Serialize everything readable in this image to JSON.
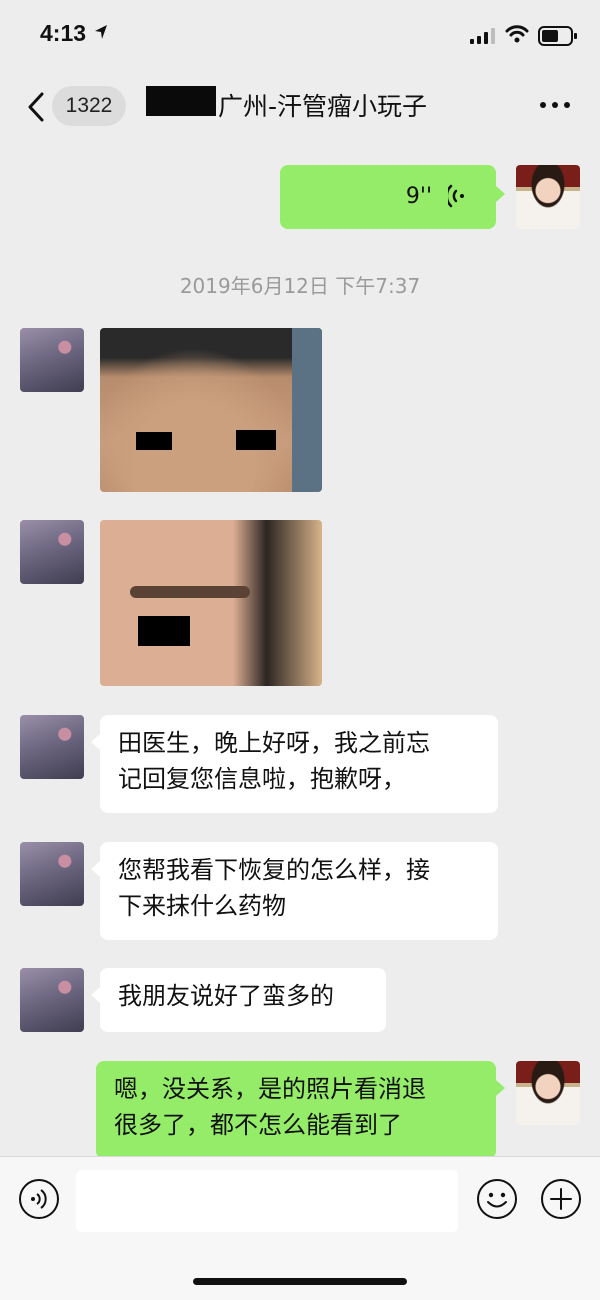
{
  "status_bar": {
    "time": "4:13"
  },
  "nav": {
    "unread_count": "1322",
    "title": "广州-汗管瘤小玩子"
  },
  "messages": {
    "voice": {
      "duration": "9''"
    },
    "timestamp": "2019年6月12日 下午7:37",
    "text_1": "田医生，晚上好呀，我之前忘\n记回复您信息啦，抱歉呀，",
    "text_2": "您帮我看下恢复的怎么样，接\n下来抹什么药物",
    "text_3": "我朋友说好了蛮多的",
    "reply_1": "嗯，没关系，是的照片看消退\n很多了，都不怎么能看到了"
  },
  "input": {
    "placeholder": ""
  },
  "colors": {
    "background": "#ededed",
    "sent_bubble": "#95ec69",
    "received_bubble": "#ffffff"
  }
}
